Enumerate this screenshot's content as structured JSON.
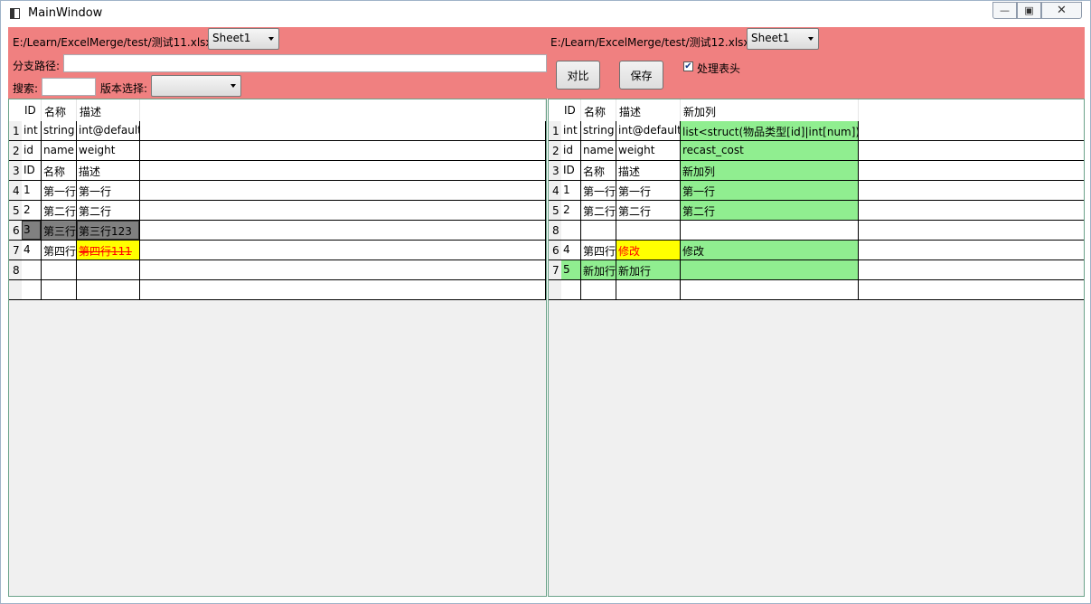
{
  "window": {
    "title": "MainWindow",
    "min_glyph": "—",
    "max_glyph": "▣",
    "close_glyph": "✕"
  },
  "toolbar": {
    "left_file": "E:/Learn/ExcelMerge/test/测试11.xlsx",
    "left_sheet": "Sheet1",
    "branch_label": "分支路径:",
    "branch_value": "",
    "search_label": "搜索:",
    "search_value": "",
    "version_label": "版本选择:",
    "version_value": "",
    "right_file": "E:/Learn/ExcelMerge/test/测试12.xlsx",
    "right_sheet": "Sheet1",
    "compare_label": "对比",
    "save_label": "保存",
    "handle_header_label": "处理表头",
    "handle_header_checked": true,
    "check_glyph": "✔"
  },
  "colors": {
    "toolbar_bg": "#f08080",
    "deleted": "#808080",
    "modified": "#ffff00",
    "added": "#90ee90",
    "modified_text": "#ff0000"
  },
  "left_grid": {
    "headers": [
      "ID",
      "名称",
      "描述"
    ],
    "rows": [
      {
        "num": "1",
        "cells": [
          "int",
          "string",
          "int@default"
        ]
      },
      {
        "num": "2",
        "cells": [
          "id",
          "name",
          "weight"
        ]
      },
      {
        "num": "3",
        "cells": [
          "ID",
          "名称",
          "描述"
        ]
      },
      {
        "num": "4",
        "cells": [
          "1",
          "第一行",
          "第一行"
        ]
      },
      {
        "num": "5",
        "cells": [
          "2",
          "第二行",
          "第二行"
        ]
      },
      {
        "num": "6",
        "cells": [
          "3",
          "第三行",
          "第三行123"
        ]
      },
      {
        "num": "7",
        "cells": [
          "4",
          "第四行",
          "第四行111"
        ]
      },
      {
        "num": "8",
        "cells": [
          "",
          "",
          ""
        ]
      },
      {
        "num": "",
        "cells": [
          "",
          "",
          ""
        ]
      }
    ]
  },
  "right_grid": {
    "headers": [
      "ID",
      "名称",
      "描述",
      "新加列"
    ],
    "rows": [
      {
        "num": "1",
        "cells": [
          "int",
          "string",
          "int@default",
          "list<struct(物品类型[id]|int[num])>"
        ]
      },
      {
        "num": "2",
        "cells": [
          "id",
          "name",
          "weight",
          "recast_cost"
        ]
      },
      {
        "num": "3",
        "cells": [
          "ID",
          "名称",
          "描述",
          "新加列"
        ]
      },
      {
        "num": "4",
        "cells": [
          "1",
          "第一行",
          "第一行",
          "第一行"
        ]
      },
      {
        "num": "5",
        "cells": [
          "2",
          "第二行",
          "第二行",
          "第二行"
        ]
      },
      {
        "num": "8",
        "cells": [
          "",
          "",
          "",
          ""
        ]
      },
      {
        "num": "6",
        "cells": [
          "4",
          "第四行",
          "修改",
          "修改"
        ]
      },
      {
        "num": "7",
        "cells": [
          "5",
          "新加行",
          "新加行",
          ""
        ]
      },
      {
        "num": "",
        "cells": [
          "",
          "",
          "",
          ""
        ]
      }
    ]
  }
}
